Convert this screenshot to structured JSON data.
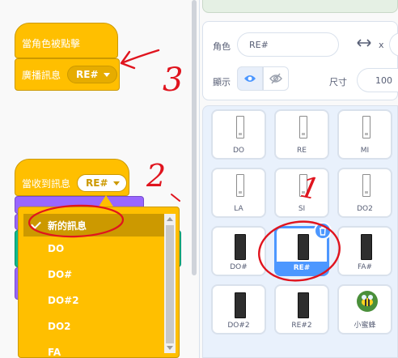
{
  "code_blocks": {
    "hat1_label": "當角色被點擊",
    "broadcast_label": "廣播訊息",
    "broadcast_value": "RE#",
    "hat2_label": "當收到訊息",
    "receive_value": "RE#"
  },
  "dropdown": {
    "items": [
      {
        "label": "新的訊息",
        "selected": true
      },
      {
        "label": "DO"
      },
      {
        "label": "DO#"
      },
      {
        "label": "DO#2"
      },
      {
        "label": "DO2"
      },
      {
        "label": "FA"
      }
    ]
  },
  "sprite_info": {
    "sprite_label": "角色",
    "sprite_name": "RE#",
    "x_label": "x",
    "show_label": "顯示",
    "size_label": "尺寸",
    "size_value": "100"
  },
  "sprites": [
    {
      "name": "DO"
    },
    {
      "name": "RE"
    },
    {
      "name": "MI"
    },
    {
      "name": "LA"
    },
    {
      "name": "SI"
    },
    {
      "name": "DO2"
    },
    {
      "name": "DO#"
    },
    {
      "name": "RE#",
      "selected": true
    },
    {
      "name": "FA#"
    },
    {
      "name": "DO#2"
    },
    {
      "name": "RE#2"
    },
    {
      "name": "小蜜蜂"
    }
  ],
  "annotations": [
    "3",
    "2",
    "1"
  ],
  "colors": {
    "events": "#ffbf00",
    "accent": "#4c97ff",
    "annotation": "#e0141e"
  }
}
